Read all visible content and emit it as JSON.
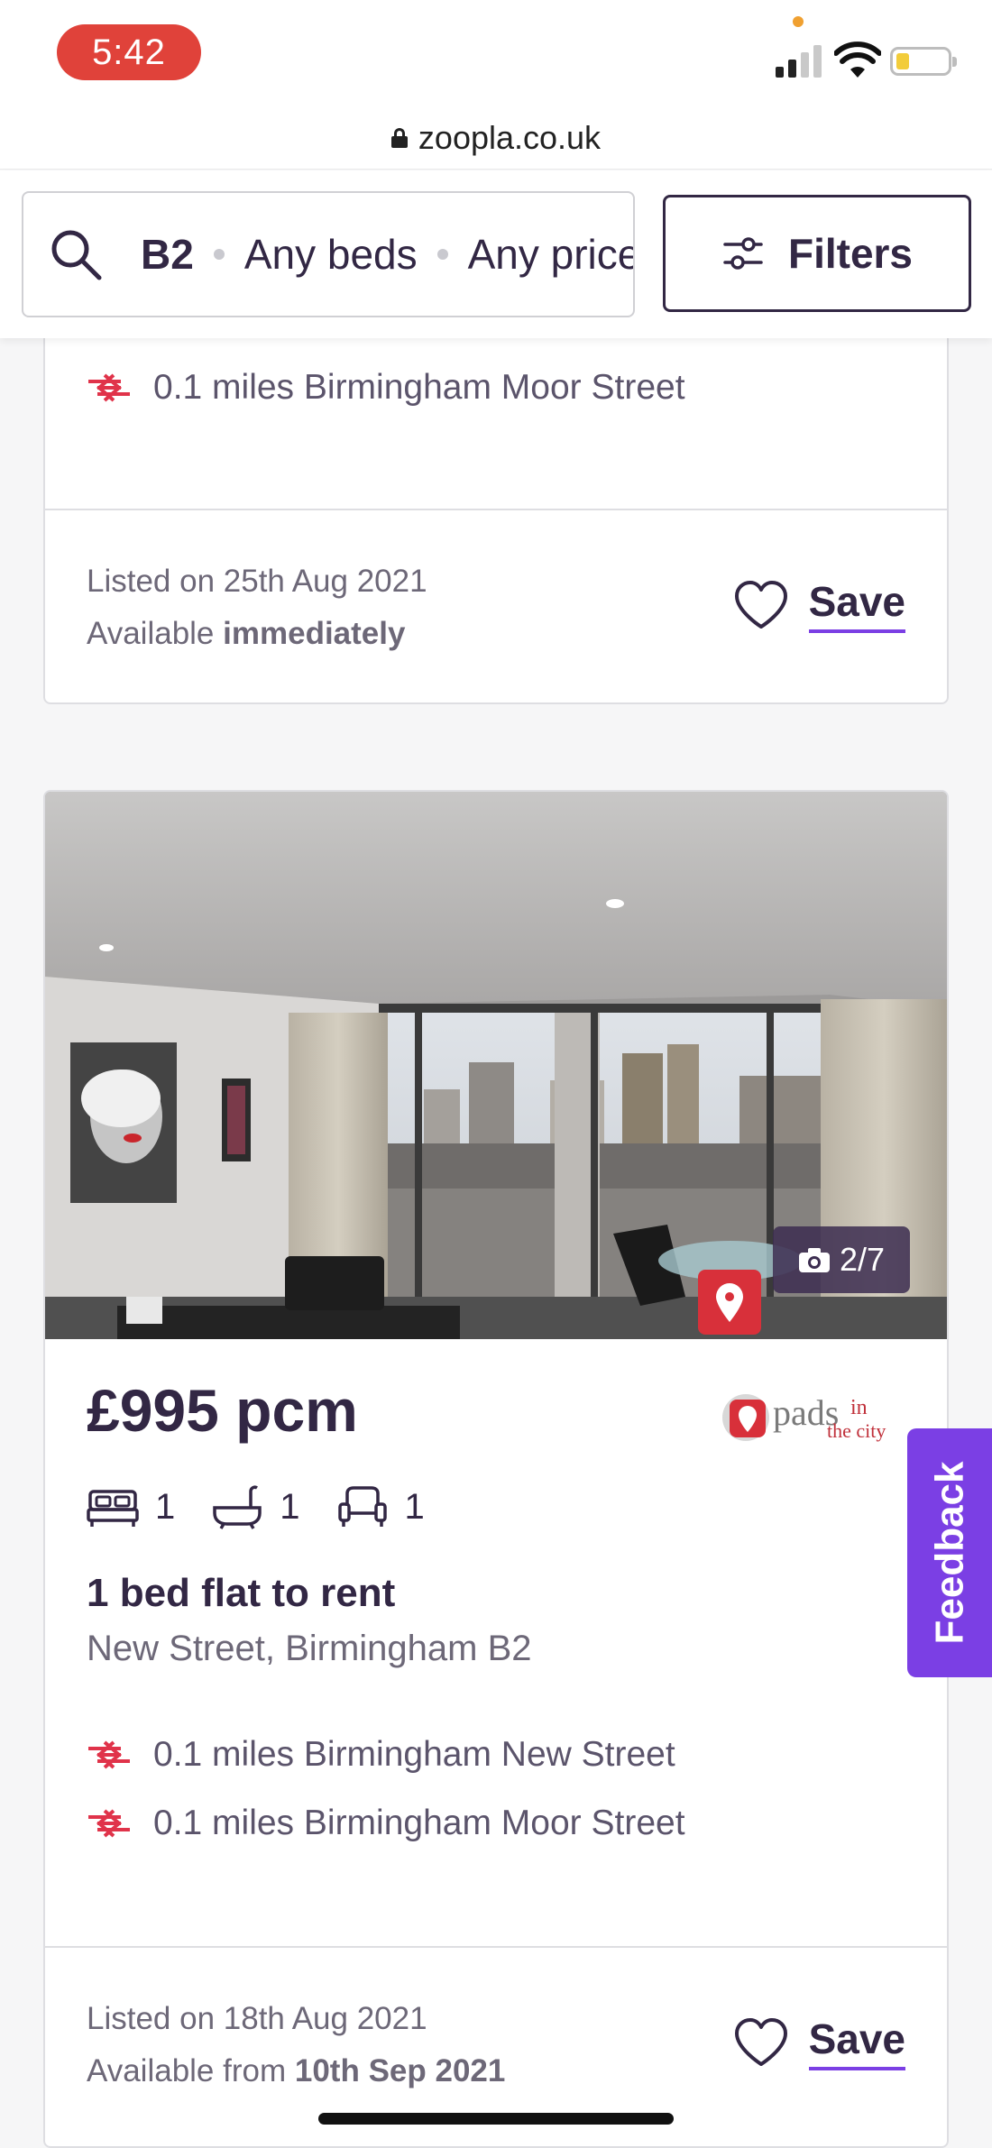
{
  "status_bar": {
    "time": "5:42"
  },
  "browser": {
    "url": "zoopla.co.uk"
  },
  "search": {
    "location": "B2",
    "beds": "Any beds",
    "price": "Any price",
    "filters_label": "Filters"
  },
  "listings": [
    {
      "stations": [
        {
          "distance": "0.1 miles Birmingham Moor Street"
        }
      ],
      "listed": "Listed on 25th Aug 2021",
      "available_prefix": "Available",
      "available_value": "immediately",
      "save_label": "Save"
    },
    {
      "photo_count": "2/7",
      "price": "£995 pcm",
      "agent": "pads in the city",
      "beds": "1",
      "baths": "1",
      "receptions": "1",
      "title": "1 bed flat to rent",
      "address": "New Street, Birmingham B2",
      "stations": [
        {
          "distance": "0.1 miles Birmingham New Street"
        },
        {
          "distance": "0.1 miles Birmingham Moor Street"
        }
      ],
      "listed": "Listed on 18th Aug 2021",
      "available_prefix": "Available from",
      "available_value": "10th Sep 2021",
      "save_label": "Save"
    }
  ],
  "feedback_label": "Feedback",
  "colors": {
    "brand_purple": "#7b3fe4",
    "text_dark": "#322744",
    "rail_red": "#e0334a"
  }
}
